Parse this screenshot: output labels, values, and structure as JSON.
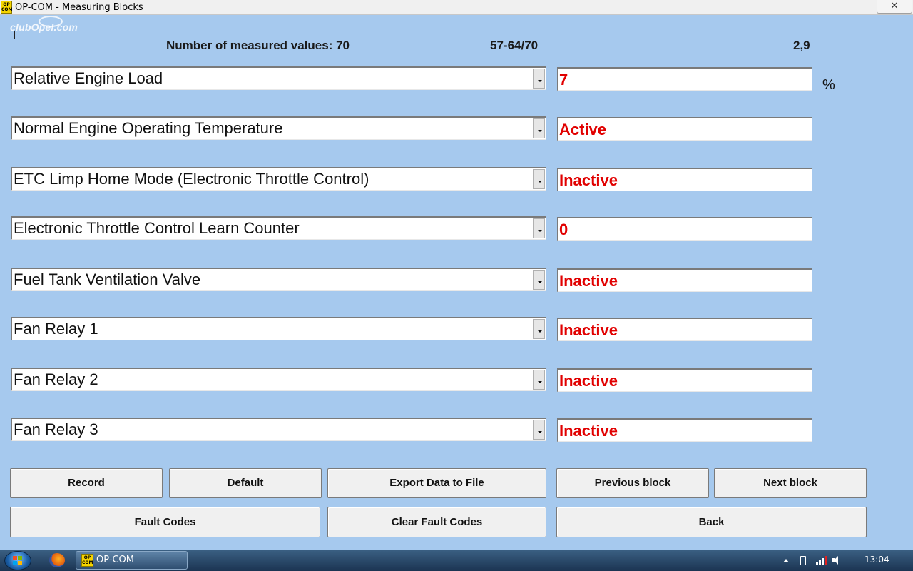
{
  "window": {
    "title": "OP-COM - Measuring Blocks",
    "app_icon_text": "OP COM",
    "close_glyph": "✕"
  },
  "watermark": {
    "text": "clubOpel.com"
  },
  "header": {
    "count_label": "Number of measured values: 70",
    "range": "57-64/70",
    "rate": "2,9"
  },
  "rows": [
    {
      "label": "Relative Engine Load",
      "value": "7",
      "unit": "%"
    },
    {
      "label": "Normal Engine Operating Temperature",
      "value": "Active"
    },
    {
      "label": "ETC Limp Home Mode (Electronic Throttle Control)",
      "value": "Inactive"
    },
    {
      "label": "Electronic Throttle Control Learn Counter",
      "value": "0"
    },
    {
      "label": "Fuel Tank Ventilation Valve",
      "value": "Inactive"
    },
    {
      "label": "Fan Relay 1",
      "value": "Inactive"
    },
    {
      "label": "Fan Relay 2",
      "value": "Inactive"
    },
    {
      "label": "Fan Relay 3",
      "value": "Inactive"
    }
  ],
  "buttons": {
    "record": "Record",
    "default": "Default",
    "export": "Export Data to File",
    "previous": "Previous block",
    "next": "Next block",
    "fault_codes": "Fault Codes",
    "clear_fault_codes": "Clear Fault Codes",
    "back": "Back"
  },
  "taskbar": {
    "app_label": "OP-COM",
    "time": "13:04"
  },
  "colors": {
    "background": "#a6c9ee",
    "value_text": "#e10000"
  }
}
